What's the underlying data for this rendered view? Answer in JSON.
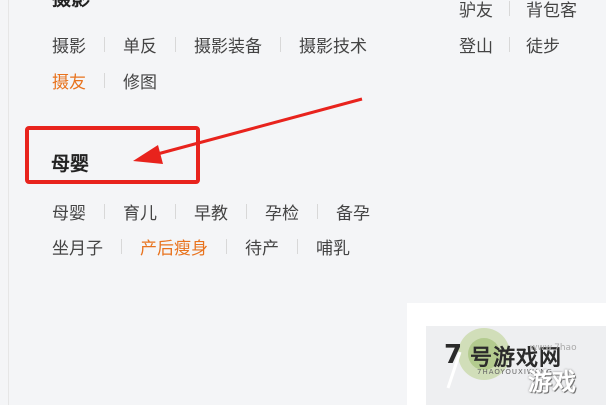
{
  "photography": {
    "title": "摄影",
    "rows": [
      [
        {
          "label": "摄影",
          "highlight": false
        },
        {
          "label": "单反",
          "highlight": false
        },
        {
          "label": "摄影装备",
          "highlight": false
        },
        {
          "label": "摄影技术",
          "highlight": false
        }
      ],
      [
        {
          "label": "摄友",
          "highlight": true
        },
        {
          "label": "修图",
          "highlight": false
        }
      ]
    ]
  },
  "outdoor": {
    "rows": [
      [
        {
          "label": "驴友"
        },
        {
          "label": "背包客"
        }
      ],
      [
        {
          "label": "登山"
        },
        {
          "label": "徒步"
        }
      ]
    ]
  },
  "maternity": {
    "title": "母婴",
    "rows": [
      [
        {
          "label": "母婴",
          "highlight": false
        },
        {
          "label": "育儿",
          "highlight": false
        },
        {
          "label": "早教",
          "highlight": false
        },
        {
          "label": "孕检",
          "highlight": false
        },
        {
          "label": "备孕",
          "highlight": false
        }
      ],
      [
        {
          "label": "坐月子",
          "highlight": false
        },
        {
          "label": "产后瘦身",
          "highlight": true
        },
        {
          "label": "待产",
          "highlight": false
        },
        {
          "label": "哺乳",
          "highlight": false
        }
      ]
    ]
  },
  "watermark": {
    "number": "7",
    "text1": "号游戏网",
    "sub": "7HAOYOUXIWANG",
    "text2": "游戏",
    "url": "www.7hao"
  },
  "colors": {
    "highlight": "#e8731e",
    "annotation": "#e8231d"
  }
}
